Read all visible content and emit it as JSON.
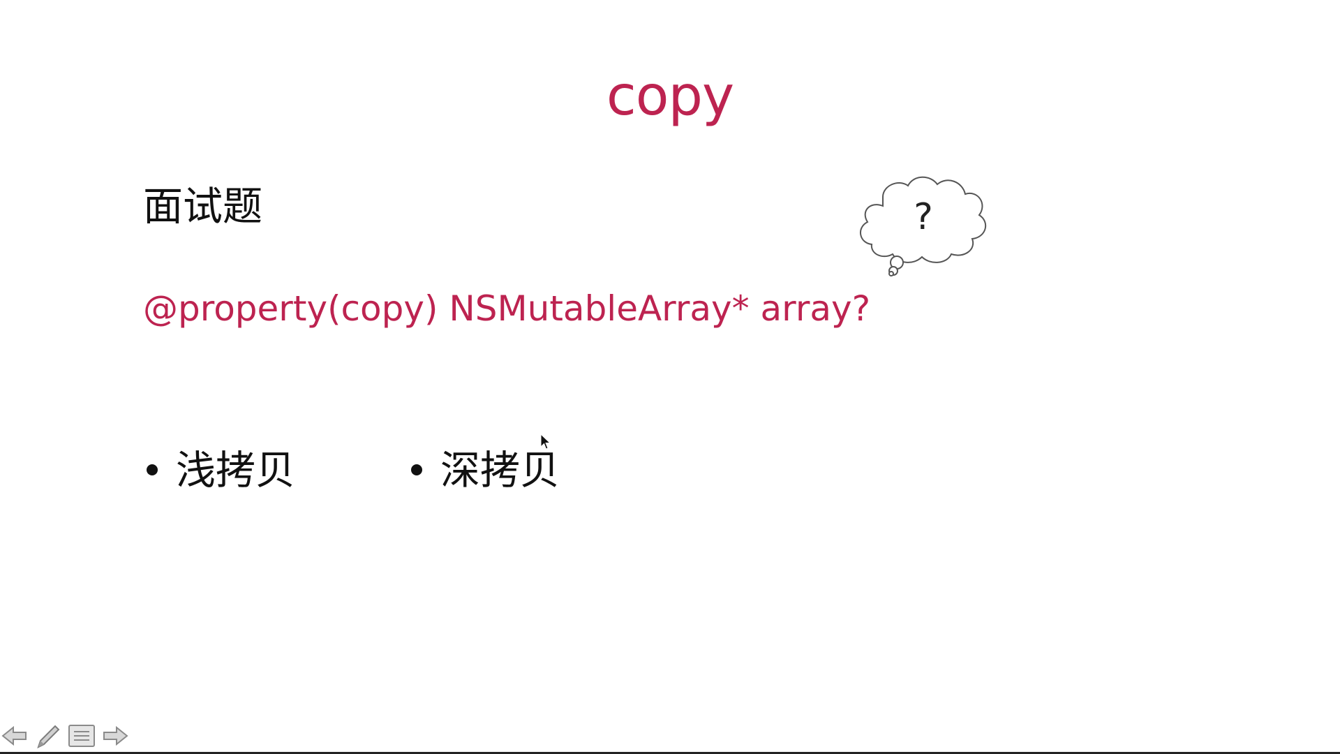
{
  "slide": {
    "title": "copy",
    "heading": "面试题",
    "code_question": "@property(copy) NSMutableArray* array?",
    "bullets": [
      {
        "label": "浅拷贝"
      },
      {
        "label": "深拷贝"
      }
    ],
    "thought_bubble": {
      "text": "?",
      "icon": "thought-cloud-icon"
    }
  },
  "toolbar": {
    "items": [
      {
        "icon": "arrow-left-icon"
      },
      {
        "icon": "pen-icon"
      },
      {
        "icon": "menu-icon"
      },
      {
        "icon": "arrow-right-icon"
      }
    ]
  },
  "colors": {
    "accent": "#bd2350",
    "text": "#111111",
    "background": "#ffffff"
  }
}
